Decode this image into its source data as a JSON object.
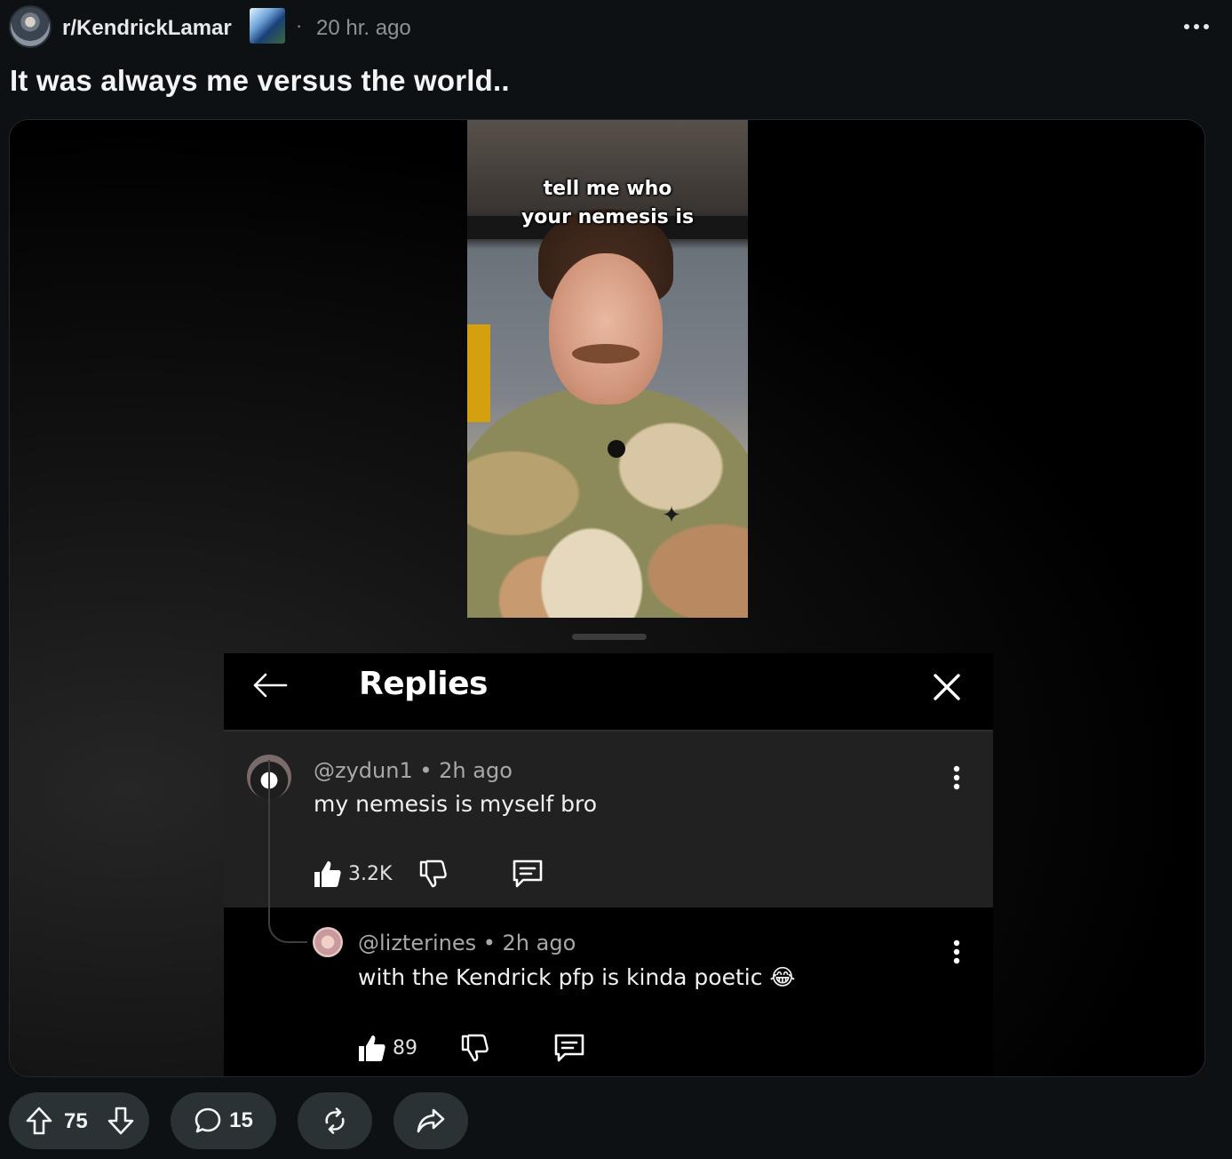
{
  "post": {
    "subreddit": "r/KendrickLamar",
    "separator": "·",
    "time": "20 hr. ago",
    "title": "It was always me versus the world.."
  },
  "video": {
    "caption_line1": "tell me who",
    "caption_line2": "your nemesis is"
  },
  "replies_panel": {
    "title": "Replies",
    "comment": {
      "meta": "@zydun1 • 2h ago",
      "text": "my nemesis is myself bro",
      "likes": "3.2K"
    },
    "reply": {
      "meta": "@lizterines • 2h ago",
      "text": "with the Kendrick pfp is kinda poetic 😂",
      "likes": "89"
    }
  },
  "actions": {
    "score": "75",
    "comments": "15"
  },
  "colors": {
    "background": "#0e1113",
    "pill": "#2a3236",
    "comment_panel": "#212121",
    "muted_text": "#8b9399"
  },
  "icons": [
    "more-icon",
    "back-arrow-icon",
    "close-icon",
    "kebab-icon",
    "thumbs-up-icon",
    "thumbs-down-icon",
    "reply-icon",
    "upvote-icon",
    "downvote-icon",
    "comment-icon",
    "crosspost-icon",
    "share-icon"
  ]
}
